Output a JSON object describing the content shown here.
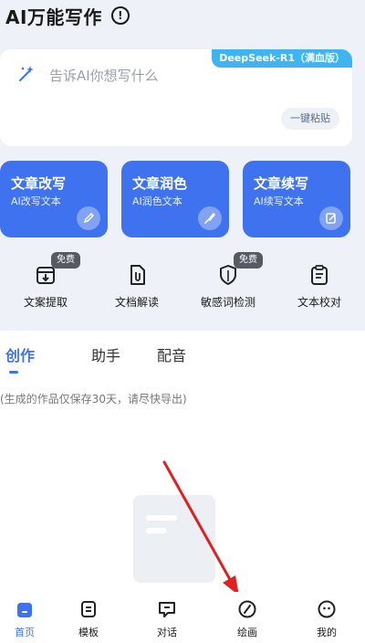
{
  "header": {
    "title": "AI万能写作",
    "info_icon": "info-icon"
  },
  "prompt": {
    "model_badge": "DeepSeek-R1（满血版）",
    "placeholder": "告诉AI你想写什么",
    "paste_label": "一键粘贴"
  },
  "features": [
    {
      "title": "文章改写",
      "subtitle": "AI改写文本",
      "icon": "pen-circle-icon"
    },
    {
      "title": "文章润色",
      "subtitle": "AI润色文本",
      "icon": "brush-icon"
    },
    {
      "title": "文章续写",
      "subtitle": "AI续写文本",
      "icon": "edit-doc-icon"
    }
  ],
  "tools": [
    {
      "label": "文案提取",
      "badge": "免费",
      "icon": "download-box-icon"
    },
    {
      "label": "文档解读",
      "badge": "",
      "icon": "document-clip-icon"
    },
    {
      "label": "敏感词检测",
      "badge": "免费",
      "icon": "shield-icon"
    },
    {
      "label": "文本校对",
      "badge": "",
      "icon": "clipboard-icon"
    }
  ],
  "tabs": [
    {
      "label": "创作",
      "active": true
    },
    {
      "label": "助手",
      "active": false
    },
    {
      "label": "配音",
      "active": false
    }
  ],
  "save_note": "(生成的作品仅保存30天，请尽快导出)",
  "nav": [
    {
      "label": "首页",
      "icon": "home-icon",
      "active": true
    },
    {
      "label": "模板",
      "icon": "template-icon",
      "active": false
    },
    {
      "label": "对话",
      "icon": "chat-icon",
      "active": false
    },
    {
      "label": "绘画",
      "icon": "draw-icon",
      "active": false
    },
    {
      "label": "我的",
      "icon": "profile-icon",
      "active": false
    }
  ],
  "colors": {
    "accent": "#3f72ee",
    "badge": "#3fb4f0",
    "annotation_arrow": "#e02020"
  }
}
